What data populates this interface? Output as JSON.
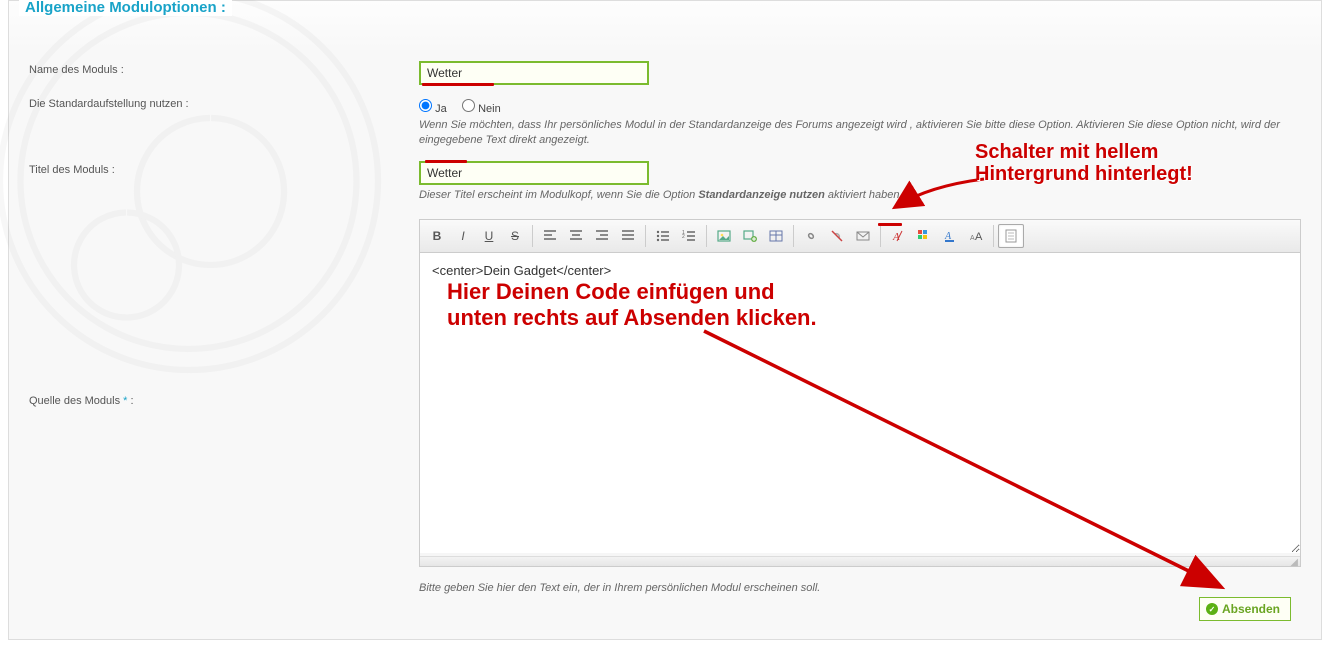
{
  "legend": "Allgemeine Moduloptionen :",
  "labels": {
    "moduleName": "Name des Moduls :",
    "useDefault": "Die Standardaufstellung nutzen :",
    "moduleTitle": "Titel des Moduls :",
    "moduleSource": "Quelle des Moduls",
    "sourceSuffix": ":"
  },
  "fields": {
    "moduleNameValue": "Wetter",
    "radio": {
      "yes": "Ja",
      "no": "Nein",
      "selected": "yes"
    },
    "useDefaultHint": "Wenn Sie möchten, dass Ihr persönliches Modul in der Standardanzeige des Forums angezeigt wird , aktivieren Sie bitte diese Option. Aktivieren Sie diese Option nicht, wird der eingegebene Text direkt angezeigt.",
    "moduleTitleValue": "Wetter",
    "moduleTitleHintPre": "Dieser Titel erscheint im Modulkopf, wenn Sie die Option ",
    "moduleTitleHintBold": "Standardanzeige nutzen",
    "moduleTitleHintPost": " aktiviert haben",
    "editorContent": "<center>Dein Gadget</center>",
    "editorHint": "Bitte geben Sie hier den Text ein, der in Ihrem persönlichen Modul erscheinen soll."
  },
  "toolbar": {
    "bold": "B",
    "italic": "I",
    "underline": "U",
    "strike": "S",
    "source": "source"
  },
  "submit": "Absenden",
  "annotations": {
    "top1": "Schalter mit hellem",
    "top2": "Hintergrund hinterlegt!",
    "mid1": "Hier Deinen Code einfügen und",
    "mid2": "unten rechts auf Absenden klicken."
  }
}
